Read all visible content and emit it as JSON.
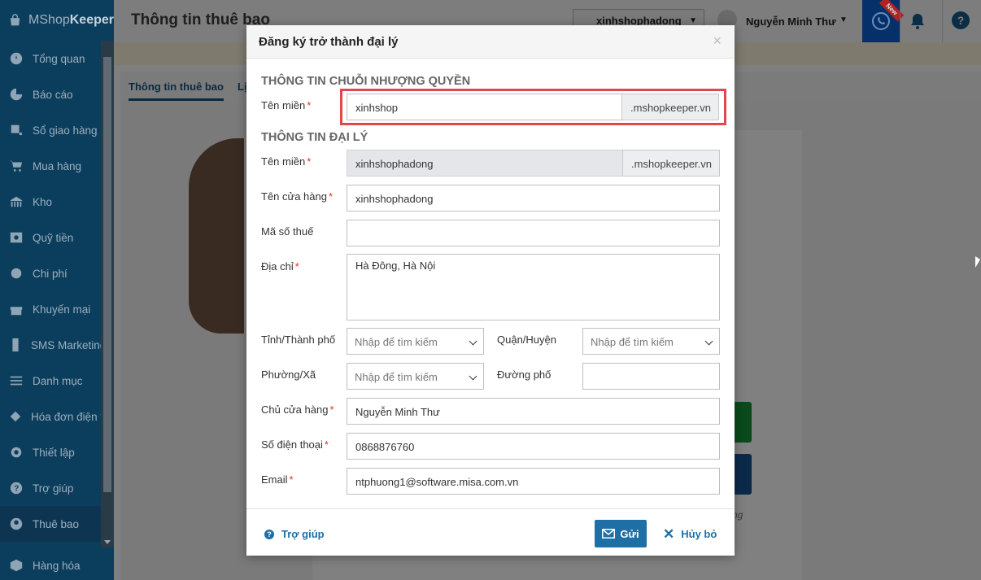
{
  "app": {
    "logo_prefix": "MShop",
    "logo_suffix": "Keeper"
  },
  "sidebar": {
    "items": [
      {
        "label": "Tổng quan",
        "icon": "dashboard-icon"
      },
      {
        "label": "Báo cáo",
        "icon": "chart-icon"
      },
      {
        "label": "Sổ giao hàng",
        "icon": "delivery-icon"
      },
      {
        "label": "Mua hàng",
        "icon": "cart-icon"
      },
      {
        "label": "Kho",
        "icon": "warehouse-icon"
      },
      {
        "label": "Quỹ tiền",
        "icon": "safe-icon"
      },
      {
        "label": "Chi phí",
        "icon": "expense-icon"
      },
      {
        "label": "Khuyến mại",
        "icon": "gift-icon"
      },
      {
        "label": "SMS Marketing",
        "icon": "phone-icon"
      },
      {
        "label": "Danh mục",
        "icon": "list-icon"
      },
      {
        "label": "Hóa đơn điện tử",
        "icon": "invoice-icon"
      },
      {
        "label": "Thiết lập",
        "icon": "gear-icon"
      },
      {
        "label": "Trợ giúp",
        "icon": "help-icon"
      },
      {
        "label": "Thuê bao",
        "icon": "user-icon"
      }
    ],
    "bottom_item": {
      "label": "Hàng hóa",
      "icon": "box-icon"
    }
  },
  "header": {
    "title": "Thông tin thuê bao",
    "shop_select_value": "xinhshophadong",
    "user_name": "Nguyễn Minh Thư",
    "new_badge": "New"
  },
  "content": {
    "tabs": [
      "Thông tin thuê bao",
      "Lị"
    ],
    "partial_text": "ng"
  },
  "modal": {
    "title": "Đăng ký trở thành đại lý",
    "close": "×",
    "section_franchise": "THÔNG TIN CHUỖI NHƯỢNG QUYỀN",
    "section_agent": "THÔNG TIN ĐẠI LÝ",
    "franchise_domain": {
      "label": "Tên miền",
      "value": "xinhshop",
      "suffix": ".mshopkeeper.vn"
    },
    "agent_domain": {
      "label": "Tên miền",
      "value": "xinhshophadong",
      "suffix": ".mshopkeeper.vn"
    },
    "store_name": {
      "label": "Tên cửa hàng",
      "value": "xinhshophadong"
    },
    "tax_code": {
      "label": "Mã số thuế",
      "value": ""
    },
    "address": {
      "label": "Địa chỉ",
      "value": "Hà Đông, Hà Nội"
    },
    "province": {
      "label": "Tỉnh/Thành phố",
      "placeholder": "Nhập để tìm kiếm"
    },
    "district": {
      "label": "Quận/Huyện",
      "placeholder": "Nhập để tìm kiếm"
    },
    "ward": {
      "label": "Phường/Xã",
      "placeholder": "Nhập để tìm kiếm"
    },
    "street": {
      "label": "Đường phố",
      "value": ""
    },
    "owner": {
      "label": "Chủ cửa hàng",
      "value": "Nguyễn Minh Thư"
    },
    "phone": {
      "label": "Số điện thoại",
      "value": "0868876760"
    },
    "email": {
      "label": "Email",
      "value": "ntphuong1@software.misa.com.vn"
    },
    "required_mark": "*",
    "footer": {
      "help": "Trợ giúp",
      "help_icon": "?",
      "send": "Gửi",
      "cancel": "Hủy bỏ",
      "cancel_icon": "✕"
    }
  },
  "colors": {
    "primary": "#1d6fa5",
    "highlight": "#e0484a",
    "sidebar": "#0b3d5c"
  }
}
